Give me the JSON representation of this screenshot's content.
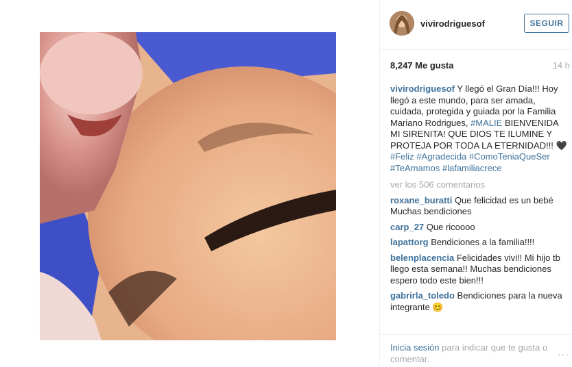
{
  "post": {
    "username": "vivirodriguesof",
    "follow_label": "SEGUIR",
    "likes": "8,247 Me gusta",
    "time": "14 h",
    "caption": {
      "username": "vivirodriguesof",
      "text_1": "Y llegó el Gran Día!!! Hoy llegó a este mundo, para ser amada, cuidada, protegida y guiada por la Familia Mariano Rodrigues,",
      "tag_1": "#MALIE",
      "text_2": "BIENVENIDA MI SIRENITA! QUE DIOS TE ILUMINE Y PROTEJA POR TODA LA ETERNIDAD!!! 🖤",
      "tags": "#Feliz #Agradecida #ComoTeniaQueSer #TeAmamos #lafamiliacrece"
    },
    "view_comments": "ver los 506 comentarios",
    "comments": [
      {
        "user": "roxane_buratti",
        "text": "Que felicidad es un bebé Muchas bendiciones"
      },
      {
        "user": "carp_27",
        "text": "Que ricoooo"
      },
      {
        "user": "lapattorg",
        "text": "Bendiciones a la familia!!!!"
      },
      {
        "user": "belenplacencia",
        "text": "Felicidades vivi!! Mi hijo tb llego esta semana!! Muchas bendiciones espero todo este bien!!!"
      },
      {
        "user": "gabrirla_toledo",
        "text": "Bendiciones para la nueva integrante 😊"
      }
    ],
    "footer": {
      "login_link": "Inicia sesión",
      "login_rest": "para indicar que te gusta o comentar.",
      "more_icon": "···"
    }
  },
  "icons": [
    "more-options-icon"
  ]
}
